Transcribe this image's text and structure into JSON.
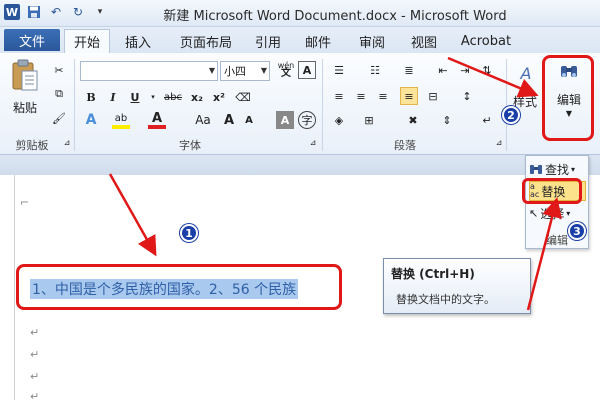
{
  "window": {
    "title": "新建 Microsoft Word Document.docx  -  Microsoft Word",
    "app_icon": "W",
    "quick_access": [
      "save-icon",
      "undo-icon",
      "redo-icon",
      "customize-icon"
    ]
  },
  "tabs": {
    "file": "文件",
    "items": [
      "开始",
      "插入",
      "页面布局",
      "引用",
      "邮件",
      "审阅",
      "视图",
      "Acrobat"
    ],
    "active": "开始"
  },
  "ribbon": {
    "clipboard": {
      "paste": "粘贴",
      "group": "剪贴板"
    },
    "font": {
      "font_name": "",
      "font_size": "小四",
      "phonetic": "wén",
      "group": "字体",
      "bold": "B",
      "italic": "I",
      "underline": "U",
      "strike": "abc",
      "subscript": "x₂",
      "superscript": "x²",
      "text_effect": "A",
      "highlight": "ab",
      "font_color": "A",
      "grow": "A",
      "shrink": "A",
      "case": "Aa",
      "shade": "A",
      "enclose": "字"
    },
    "paragraph": {
      "group": "段落"
    },
    "styles": {
      "label": "样式"
    },
    "editing": {
      "label": "编辑"
    }
  },
  "editing_menu": {
    "items": [
      {
        "label": "查找",
        "icon": "binoculars-icon"
      },
      {
        "label": "替换",
        "icon": "replace-icon"
      },
      {
        "label": "选择",
        "icon": "cursor-icon"
      }
    ],
    "highlighted": "替换",
    "caption": "编辑"
  },
  "tooltip": {
    "title": "替换 (Ctrl+H)",
    "description": "替换文档中的文字。"
  },
  "document": {
    "selected_text": "1、中国是个多民族的国家。2、56 个民族",
    "paragraph_mark": "↵"
  },
  "annotations": {
    "badges": [
      "1",
      "2",
      "3"
    ],
    "color": "#e01818",
    "badge_color": "#1b3fa8"
  }
}
